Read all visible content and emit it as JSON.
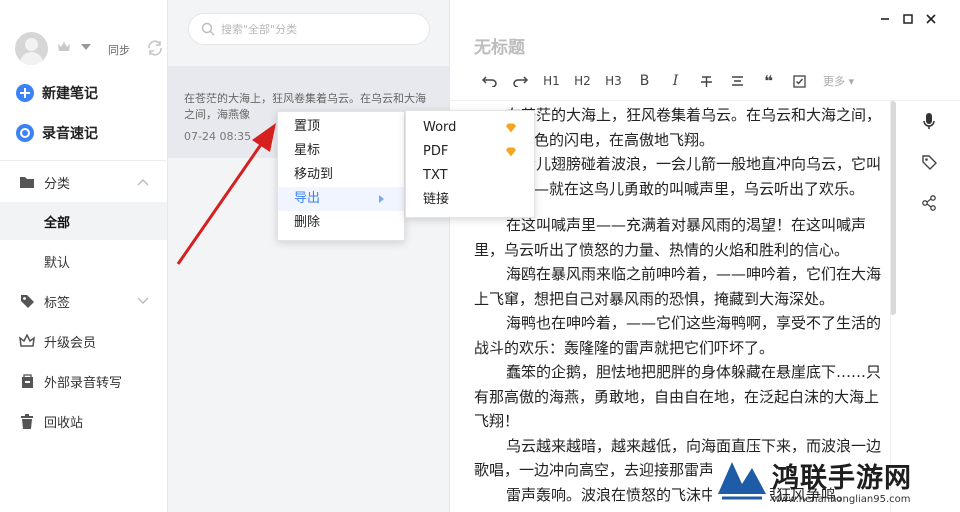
{
  "sidebar": {
    "sync_label": "同步",
    "actions": [
      {
        "label": "新建笔记",
        "icon": "plus-circle-icon"
      },
      {
        "label": "录音速记",
        "icon": "record-circle-icon"
      }
    ],
    "nav": [
      {
        "label": "分类",
        "icon": "folder-icon"
      },
      {
        "label": "全部",
        "active": true
      },
      {
        "label": "默认"
      },
      {
        "label": "标签",
        "icon": "tag-icon"
      },
      {
        "label": "升级会员",
        "icon": "crown-icon"
      },
      {
        "label": "外部录音转写",
        "icon": "recorder-icon"
      },
      {
        "label": "回收站",
        "icon": "trash-icon"
      }
    ]
  },
  "note_list": {
    "search_placeholder": "搜索\"全部\"分类",
    "notes": [
      {
        "snippet": "在苍茫的大海上，狂风卷集着乌云。在乌云和大海之间，海燕像",
        "date": "07-24 08:35"
      }
    ]
  },
  "context_menu": {
    "items": [
      "置顶",
      "星标",
      "移动到",
      "导出",
      "删除"
    ],
    "highlighted": "导出"
  },
  "export_submenu": {
    "items": [
      {
        "label": "Word",
        "premium": true
      },
      {
        "label": "PDF",
        "premium": true
      },
      {
        "label": "TXT",
        "premium": false
      },
      {
        "label": "链接",
        "premium": false
      }
    ],
    "premium_color": "#f5a623"
  },
  "editor": {
    "title_placeholder": "无标题",
    "toolbar": {
      "h1": "H1",
      "h2": "H2",
      "h3": "H3",
      "bold": "B",
      "italic": "I",
      "quote": "❝",
      "more": "更多"
    },
    "paragraphs": [
      "在苍茫的大海上，狂风卷集着乌云。在乌云和大海之间，海燕像黑色的闪电，在高傲地飞翔。",
      "一会儿翅膀碰着波浪，一会儿箭一般地直冲向乌云，它叫喊着，——就在这鸟儿勇敢的叫喊声里，乌云听出了欢乐。",
      "在这叫喊声里——充满着对暴风雨的渴望！在这叫喊声里，乌云听出了愤怒的力量、热情的火焰和胜利的信心。",
      "海鸥在暴风雨来临之前呻吟着，——呻吟着，它们在大海上飞窜，想把自己对暴风雨的恐惧，掩藏到大海深处。",
      "海鸭也在呻吟着，——它们这些海鸭啊，享受不了生活的战斗的欢乐：轰隆隆的雷声就把它们吓坏了。",
      "蠢笨的企鹅，胆怯地把肥胖的身体躲藏在悬崖底下……只有那高傲的海燕，勇敢地，自由自在地，在泛起白沫的大海上飞翔！",
      "乌云越来越暗，越来越低，向海面直压下来，而波浪一边歌唱，一边冲向高空，去迎接那雷声。",
      "雷声轰响。波浪在愤怒的飞沫中呼叫，跟狂风争鸣。"
    ]
  },
  "watermark": {
    "text": "鸿联手游网",
    "url": "www.henanhonglian95.com"
  },
  "colors": {
    "accent": "#3b82f6",
    "arrow": "#d62020",
    "premium": "#f5a623"
  }
}
